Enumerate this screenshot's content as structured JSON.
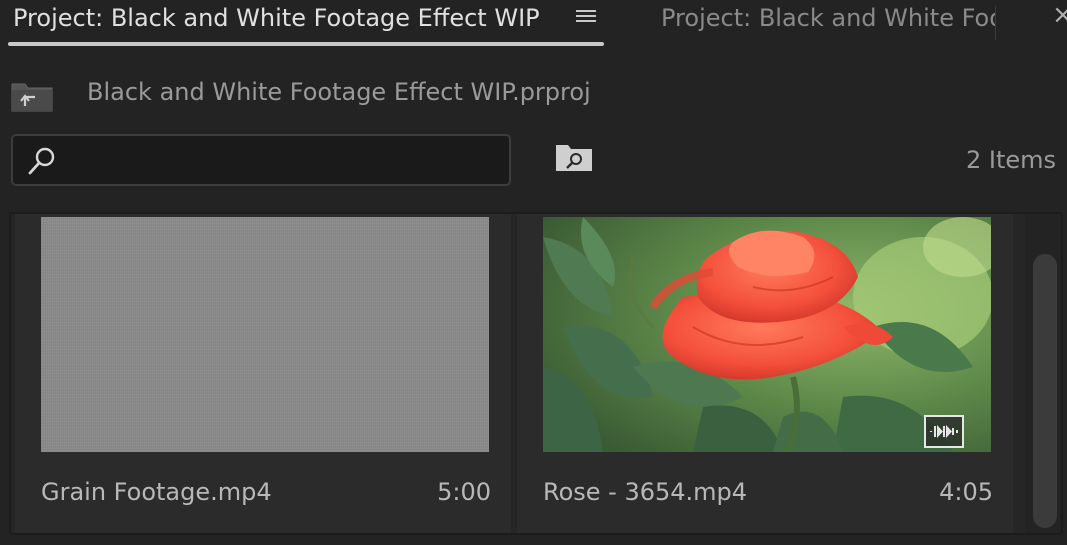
{
  "tabs": {
    "active_label": "Project: Black and White Footage Effect WIP",
    "inactive_label": "Project: Black and White Footage Effect WIP",
    "menu_icon": "hamburger-icon",
    "close_icon": "close-icon"
  },
  "path": {
    "up_icon": "folder-up-icon",
    "project_file": "Black and White Footage Effect WIP.prproj"
  },
  "search": {
    "value": "",
    "placeholder": "",
    "icon": "search-icon",
    "bin_search_icon": "find-bin-icon"
  },
  "item_count": "2 Items",
  "items": [
    {
      "name": "Grain Footage.mp4",
      "duration": "5:00",
      "thumbnail": "gray-grain"
    },
    {
      "name": "Rose - 3654.mp4",
      "duration": "4:05",
      "thumbnail": "red-rose",
      "badge_icon": "audio-waveform-icon"
    }
  ],
  "colors": {
    "panel_bg": "#232323",
    "rose": "#ff5a45",
    "leaves": "#3f6a3f"
  }
}
